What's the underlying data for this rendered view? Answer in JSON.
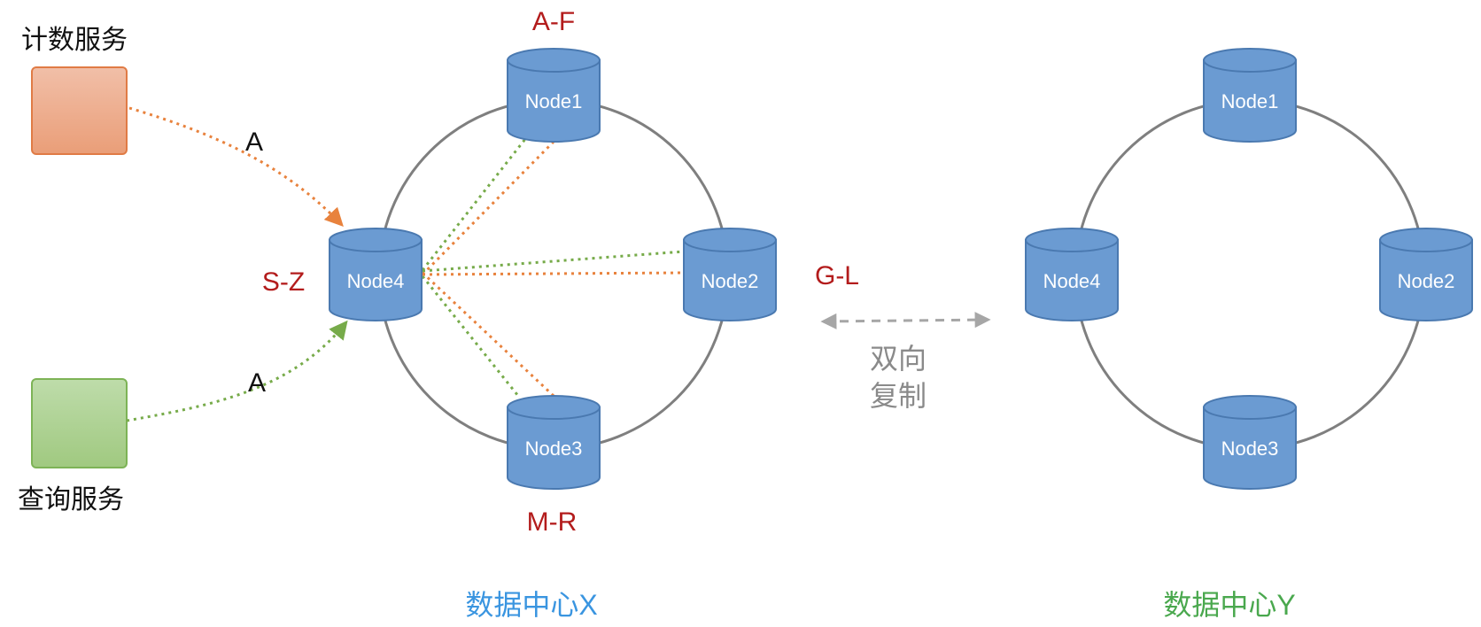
{
  "services": {
    "counting": {
      "label": "计数服务",
      "fill_top": "#f1bfa8",
      "fill_bottom": "#ea9e78",
      "stroke": "#e07b45"
    },
    "query": {
      "label": "查询服务",
      "fill_top": "#bedcaa",
      "fill_bottom": "#a0c980",
      "stroke": "#7db356"
    }
  },
  "edges": {
    "counting_to_node4": {
      "label": "A",
      "color": "#e8823d"
    },
    "query_to_node4": {
      "label": "A",
      "color": "#77ab4a"
    }
  },
  "datacenter_x": {
    "label": "数据中心X",
    "label_color": "#3a95e0",
    "nodes": {
      "node1": {
        "label": "Node1",
        "range": "A-F"
      },
      "node2": {
        "label": "Node2",
        "range": "G-L"
      },
      "node3": {
        "label": "Node3",
        "range": "M-R"
      },
      "node4": {
        "label": "Node4",
        "range": "S-Z"
      }
    }
  },
  "datacenter_y": {
    "label": "数据中心Y",
    "label_color": "#4aa84e",
    "nodes": {
      "node1": {
        "label": "Node1"
      },
      "node2": {
        "label": "Node2"
      },
      "node3": {
        "label": "Node3"
      },
      "node4": {
        "label": "Node4"
      }
    }
  },
  "replication": {
    "line1": "双向",
    "line2": "复制",
    "color": "#a6a6a6"
  },
  "colors": {
    "node_fill": "#6b9bd2",
    "node_top": "#6b9bd2",
    "node_stroke": "#4a79b0",
    "ring": "#7f7f7f",
    "range_text": "#b31c1c",
    "orange_link": "#e8823d",
    "green_link": "#77ab4a"
  }
}
